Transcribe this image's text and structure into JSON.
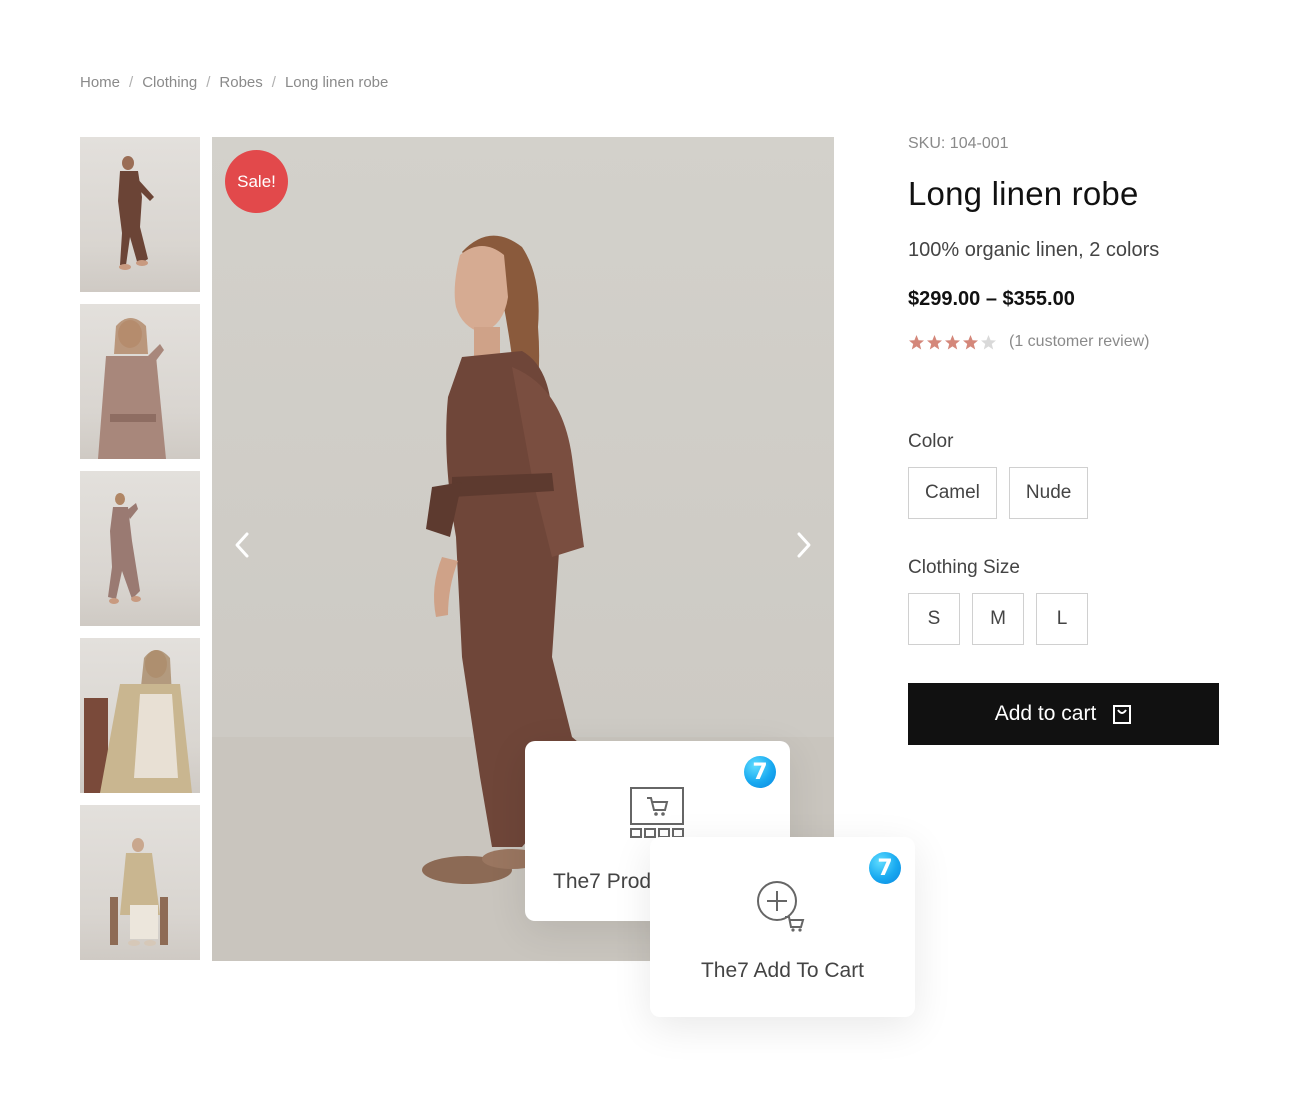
{
  "breadcrumb": {
    "items": [
      "Home",
      "Clothing",
      "Robes",
      "Long linen robe"
    ],
    "separator": "/"
  },
  "gallery": {
    "thumbnails": [
      {
        "icon": "product-photo-thumbnail-1"
      },
      {
        "icon": "product-photo-thumbnail-2"
      },
      {
        "icon": "product-photo-thumbnail-3"
      },
      {
        "icon": "product-photo-thumbnail-4"
      },
      {
        "icon": "product-photo-thumbnail-5"
      }
    ],
    "main_image_icon": "main-product-photo",
    "sale_badge": "Sale!",
    "prev_icon": "chevron-left-icon",
    "next_icon": "chevron-right-icon"
  },
  "product": {
    "sku": "SKU: 104-001",
    "title": "Long linen robe",
    "subtitle": "100% organic linen, 2 colors",
    "price": "$299.00 – $355.00",
    "rating": 4,
    "rating_max": 5,
    "review_text": "(1 customer review)",
    "color_label": "Color",
    "colors": [
      "Camel",
      "Nude"
    ],
    "size_label": "Clothing Size",
    "sizes": [
      "S",
      "M",
      "L"
    ],
    "add_to_cart": "Add to cart"
  },
  "widgets": [
    {
      "label": "The7 Prod",
      "badge": "7",
      "icon": "product-grid-icon"
    },
    {
      "label": "The7 Add To Cart",
      "badge": "7",
      "icon": "add-to-cart-icon"
    }
  ],
  "colors": {
    "sale": "#e2494b",
    "star": "#d4877a",
    "star_empty": "#d9d9d9",
    "button": "#111111",
    "badge": "#18a9f0"
  }
}
